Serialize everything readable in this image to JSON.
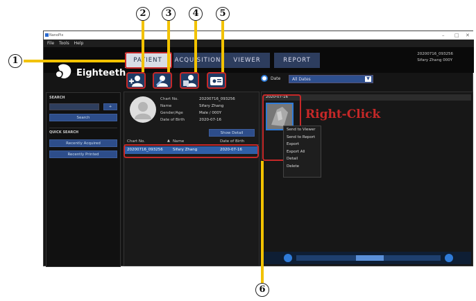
{
  "window": {
    "title": "NanoPix",
    "controls": [
      "–",
      "□",
      "✕"
    ]
  },
  "menu": [
    "File",
    "Tools",
    "Help"
  ],
  "tabs": [
    {
      "label": "PATIENT",
      "active": true
    },
    {
      "label": "ACQUISITION",
      "active": false
    },
    {
      "label": "VIEWER",
      "active": false
    },
    {
      "label": "REPORT",
      "active": false
    }
  ],
  "user": {
    "chart": "20200716_093256",
    "name": "Sifary Zhang 000Y"
  },
  "brand": "Eighteeth",
  "search": {
    "title": "SEARCH",
    "add": "+",
    "button": "Search"
  },
  "quick_search": {
    "title": "QUICK SEARCH",
    "items": [
      "Recently Acquired",
      "Recently Printed"
    ]
  },
  "patient_info": {
    "labels": [
      "Chart No.",
      "Name",
      "Gender/Age",
      "Date of Birth"
    ],
    "values": [
      "20200716_093256",
      "Sifary Zhang",
      "Male  /  000Y",
      "2020-07-16"
    ],
    "show_detail": "Show Detail"
  },
  "patient_table": {
    "headers": [
      "Chart No.",
      "Name",
      "Date of Birth"
    ],
    "sort_icon": "▲",
    "rows": [
      [
        "20200716_093256",
        "Sifary Zhang",
        "2020-07-16"
      ]
    ]
  },
  "filter": {
    "radio_label": "Date",
    "select_value": "All Dates"
  },
  "study": {
    "date": "2020-07-16"
  },
  "context_menu": [
    "Send to Viewer",
    "Send to Report",
    "Export",
    "Export All",
    "Detail",
    "Delete"
  ],
  "annotation": {
    "right_click": "Right-Click",
    "numbers": [
      "1",
      "2",
      "3",
      "4",
      "5",
      "6"
    ]
  },
  "colors": {
    "accent": "#2d4d8a",
    "annotation": "#c62828"
  }
}
